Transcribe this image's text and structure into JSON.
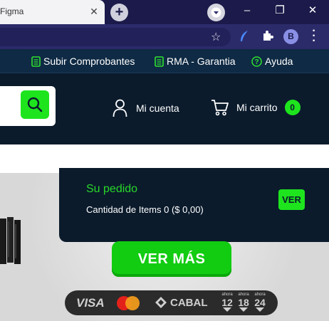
{
  "browser": {
    "tab_title": "Figma",
    "tab_close_glyph": "✕",
    "new_tab_glyph": "+",
    "profile_initial": "B",
    "window_controls": [
      "–",
      "❐",
      "✕"
    ]
  },
  "toplinks": {
    "items": [
      {
        "label": "Subir Comprobantes",
        "icon": "document-icon"
      },
      {
        "label": "RMA - Garantia",
        "icon": "document-icon"
      },
      {
        "label": "Ayuda",
        "icon": "help-icon"
      }
    ]
  },
  "header": {
    "account_label": "Mi cuenta",
    "cart_label": "Mi carrito",
    "cart_count": "0"
  },
  "order": {
    "title": "Su pedido",
    "items_text": "Cantidad de Items 0 ($ 0,00)",
    "button_label": "VER"
  },
  "hero": {
    "cta_label": "VER MÁS"
  },
  "payments": {
    "visa": "VISA",
    "cabal": "CABAL",
    "ahora_label": "ahora",
    "ahora_plans": [
      "12",
      "18",
      "24"
    ]
  },
  "colors": {
    "accent_green": "#1ee41e",
    "navy": "#0b1b2c",
    "browser_frame": "#1b1a4a"
  }
}
